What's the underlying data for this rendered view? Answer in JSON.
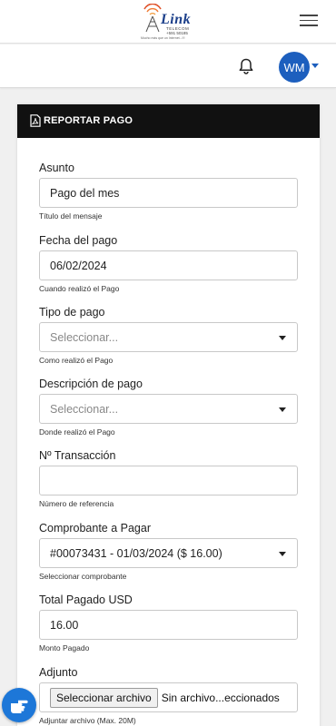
{
  "brand": {
    "name": "Link",
    "sub": "TELECOM",
    "phone": "+591 50185",
    "slogan": "Mucho más que un Internet...!!!"
  },
  "user": {
    "initials": "WM"
  },
  "card": {
    "title": "REPORTAR PAGO"
  },
  "form": {
    "asunto": {
      "label": "Asunto",
      "value": "Pago del mes",
      "help": "Título del mensaje"
    },
    "fecha": {
      "label": "Fecha del pago",
      "value": "06/02/2024",
      "help": "Cuando realizó el Pago"
    },
    "tipo": {
      "label": "Tipo de pago",
      "value": "Seleccionar...",
      "help": "Como realizó el Pago"
    },
    "descripcion": {
      "label": "Descripción de pago",
      "value": "Seleccionar...",
      "help": "Donde realizó el Pago"
    },
    "transaccion": {
      "label": "Nº Transacción",
      "value": "",
      "help": "Número de referencia"
    },
    "comprobante": {
      "label": "Comprobante a Pagar",
      "value": "#00073431 - 01/03/2024 ($ 16.00)",
      "help": "Seleccionar comprobante"
    },
    "total": {
      "label": "Total Pagado USD",
      "value": "16.00",
      "help": "Monto Pagado"
    },
    "adjunto": {
      "label": "Adjunto",
      "button": "Seleccionar archivo",
      "file_text": "Sin archivo...eccionados",
      "help": "Adjuntar archivo (Max. 20M)"
    }
  },
  "colors": {
    "accent": "#1d5fbe",
    "header": "#111111",
    "fab": "#1d77d8"
  },
  "icons": [
    "logo-antenna-icon",
    "menu-icon",
    "bell-icon",
    "caret-down-icon",
    "pdf-file-icon",
    "hand-pointer-icon"
  ]
}
